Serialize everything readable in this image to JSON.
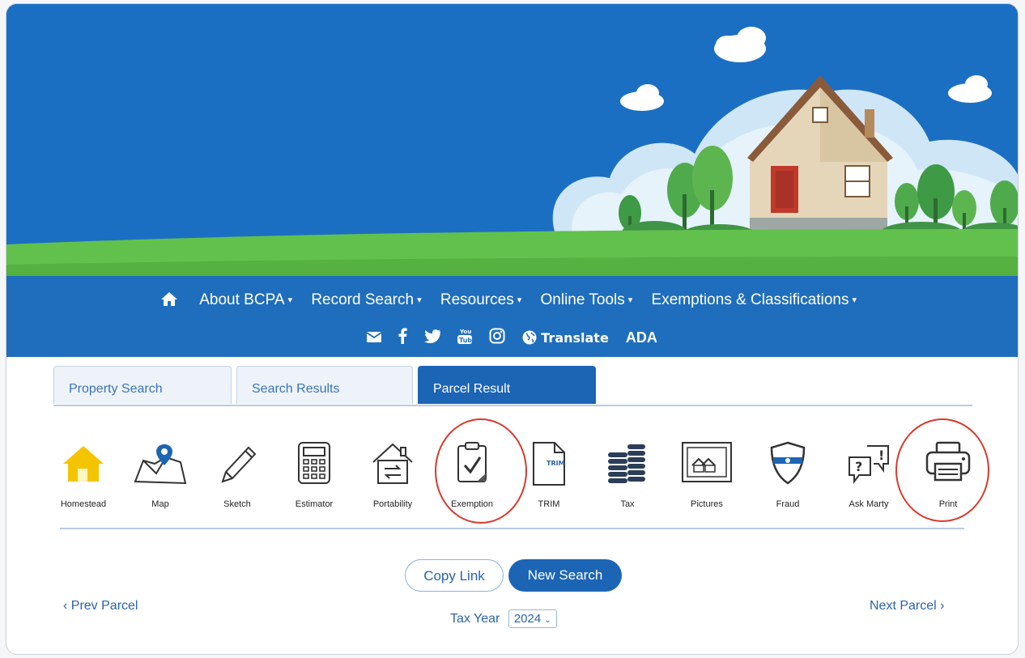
{
  "nav": {
    "home_icon": "home-icon",
    "items": [
      {
        "label": "About BCPA"
      },
      {
        "label": "Record Search"
      },
      {
        "label": "Resources"
      },
      {
        "label": "Online Tools"
      },
      {
        "label": "Exemptions & Classifications"
      }
    ],
    "caret": "▾",
    "social": [
      "envelope-icon",
      "facebook-icon",
      "twitter-icon",
      "youtube-icon",
      "instagram-icon"
    ],
    "translate": "Translate",
    "ada": "ADA"
  },
  "tabs": [
    {
      "label": "Property Search"
    },
    {
      "label": "Search Results"
    },
    {
      "label": "Parcel Result"
    }
  ],
  "tools": [
    {
      "label": "Homestead",
      "icon": "homestead-icon"
    },
    {
      "label": "Map",
      "icon": "map-icon"
    },
    {
      "label": "Sketch",
      "icon": "pencil-icon"
    },
    {
      "label": "Estimator",
      "icon": "calculator-icon"
    },
    {
      "label": "Portability",
      "icon": "portability-icon"
    },
    {
      "label": "Exemption",
      "icon": "clipboard-check-icon"
    },
    {
      "label": "TRIM",
      "icon": "trim-document-icon",
      "badge": "TRIM"
    },
    {
      "label": "Tax",
      "icon": "coins-icon"
    },
    {
      "label": "Pictures",
      "icon": "pictures-icon"
    },
    {
      "label": "Fraud",
      "icon": "shield-icon"
    },
    {
      "label": "Ask Marty",
      "icon": "question-bubble-icon"
    },
    {
      "label": "Print",
      "icon": "printer-icon"
    }
  ],
  "actions": {
    "copy_link": "Copy Link",
    "new_search": "New Search",
    "prev_parcel": "Prev Parcel",
    "next_parcel": "Next Parcel",
    "tax_year_label": "Tax Year",
    "tax_year_value": "2024"
  },
  "colors": {
    "brand_blue": "#1c65b5",
    "highlight_red": "#d63a2e",
    "homestead_yellow": "#f5c400"
  }
}
